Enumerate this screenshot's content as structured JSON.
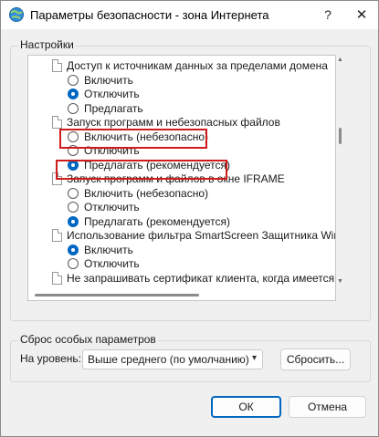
{
  "window": {
    "title": "Параметры безопасности - зона Интернета",
    "help_icon": "?",
    "close_icon": "✕"
  },
  "settings": {
    "legend": "Настройки",
    "items": [
      {
        "type": "header",
        "label": "Доступ к источникам данных за пределами домена"
      },
      {
        "type": "option",
        "label": "Включить",
        "checked": false
      },
      {
        "type": "option",
        "label": "Отключить",
        "checked": true
      },
      {
        "type": "option",
        "label": "Предлагать",
        "checked": false
      },
      {
        "type": "header",
        "label": "Запуск программ и небезопасных файлов"
      },
      {
        "type": "option",
        "label": "Включить (небезопасно)",
        "checked": false,
        "highlighted": true
      },
      {
        "type": "option",
        "label": "Отключить",
        "checked": false
      },
      {
        "type": "option",
        "label": "Предлагать (рекомендуется)",
        "checked": true,
        "highlighted": true
      },
      {
        "type": "header",
        "label": "Запуск программ и файлов в окне IFRAME"
      },
      {
        "type": "option",
        "label": "Включить (небезопасно)",
        "checked": false
      },
      {
        "type": "option",
        "label": "Отключить",
        "checked": false
      },
      {
        "type": "option",
        "label": "Предлагать (рекомендуется)",
        "checked": true
      },
      {
        "type": "header",
        "label": "Использование фильтра SmartScreen Защитника Windows"
      },
      {
        "type": "option",
        "label": "Включить",
        "checked": true
      },
      {
        "type": "option",
        "label": "Отключить",
        "checked": false
      },
      {
        "type": "header",
        "label": "Не запрашивать сертификат клиента, когда имеется только"
      }
    ]
  },
  "reset": {
    "legend": "Сброс особых параметров",
    "level_label": "На уровень:",
    "level_value": "Выше среднего (по умолчанию)",
    "reset_button": "Сбросить..."
  },
  "footer": {
    "ok": "ОК",
    "cancel": "Отмена"
  },
  "colors": {
    "accent": "#0067c0",
    "highlight": "#d01b1b"
  }
}
